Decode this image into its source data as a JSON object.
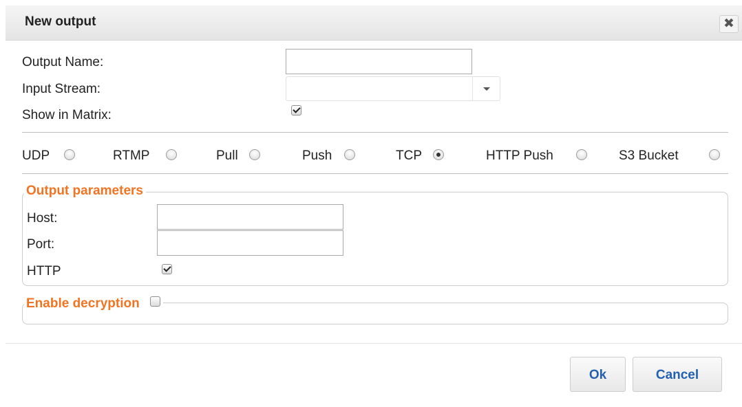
{
  "dialog": {
    "title": "New output",
    "close_symbol": "✖"
  },
  "form": {
    "output_name_label": "Output Name:",
    "output_name_value": "",
    "input_stream_label": "Input Stream:",
    "input_stream_value": "",
    "show_in_matrix_label": "Show in Matrix:",
    "show_in_matrix_checked": true
  },
  "output_types": [
    {
      "label": "UDP",
      "selected": false
    },
    {
      "label": "RTMP",
      "selected": false
    },
    {
      "label": "Pull",
      "selected": false
    },
    {
      "label": "Push",
      "selected": false
    },
    {
      "label": "TCP",
      "selected": true
    },
    {
      "label": "HTTP Push",
      "selected": false
    },
    {
      "label": "S3 Bucket",
      "selected": false
    }
  ],
  "output_parameters": {
    "legend": "Output parameters",
    "host_label": "Host:",
    "host_value": "",
    "port_label": "Port:",
    "port_value": "",
    "http_label": "HTTP",
    "http_checked": true
  },
  "decryption": {
    "legend": "Enable decryption",
    "checked": false
  },
  "buttons": {
    "ok": "Ok",
    "cancel": "Cancel"
  },
  "colors": {
    "accent": "#f07422",
    "button_text": "#2361b0"
  }
}
